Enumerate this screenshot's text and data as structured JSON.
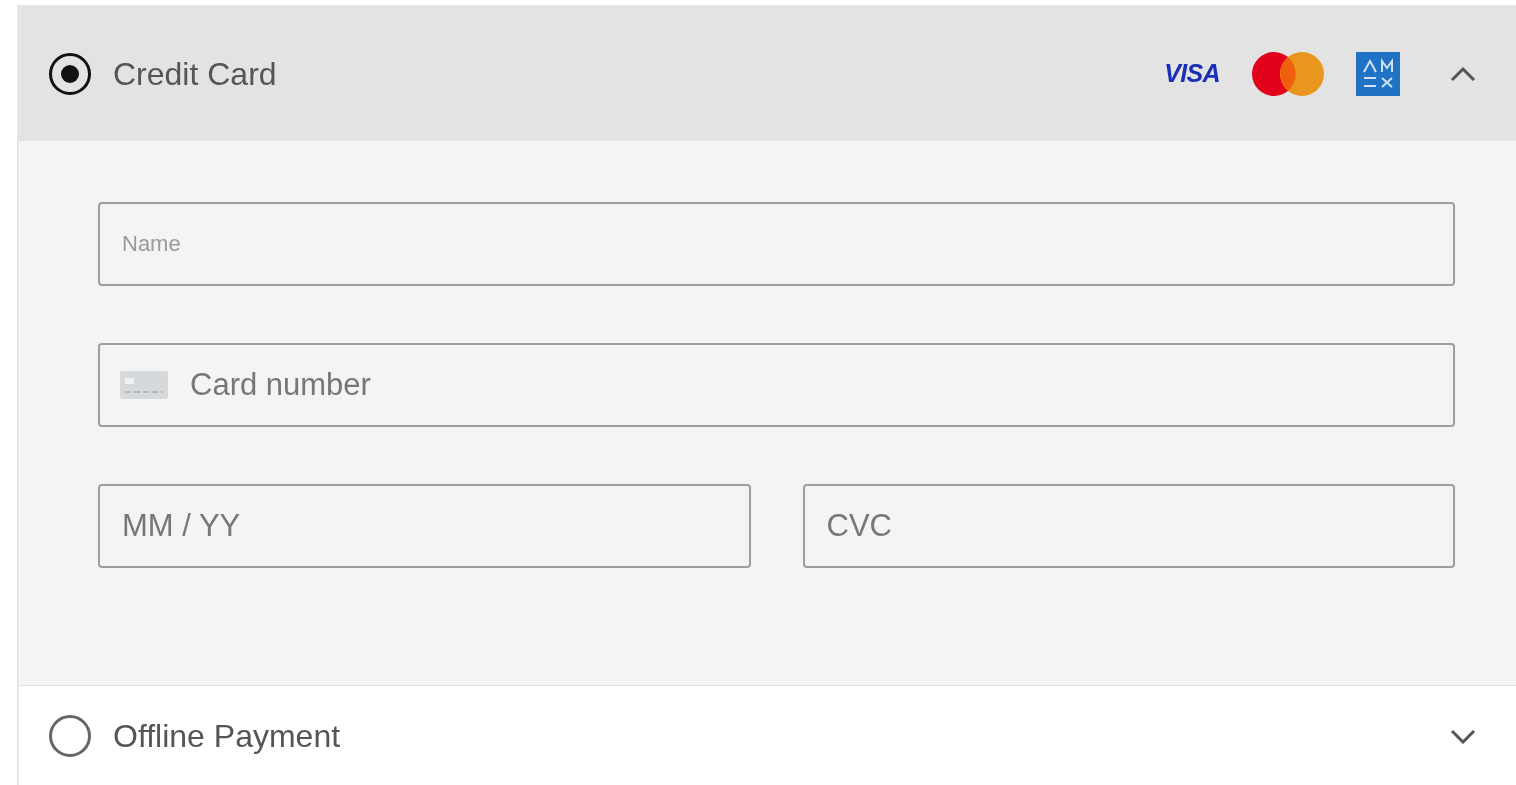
{
  "payment_methods": [
    {
      "label": "Credit Card",
      "selected": true,
      "expanded": true,
      "brand_logos": [
        {
          "kind": "visa",
          "text": "VISA"
        },
        {
          "kind": "mastercard"
        },
        {
          "kind": "amex"
        }
      ],
      "field_rows": [
        [
          {
            "kind": "compact",
            "placeholder": "Name"
          }
        ],
        [
          {
            "kind": "card",
            "placeholder": "Card number"
          }
        ],
        [
          {
            "kind": "text",
            "placeholder": "MM / YY"
          },
          {
            "kind": "text",
            "placeholder": "CVC"
          }
        ]
      ]
    },
    {
      "label": "Offline Payment",
      "selected": false,
      "expanded": false
    }
  ]
}
